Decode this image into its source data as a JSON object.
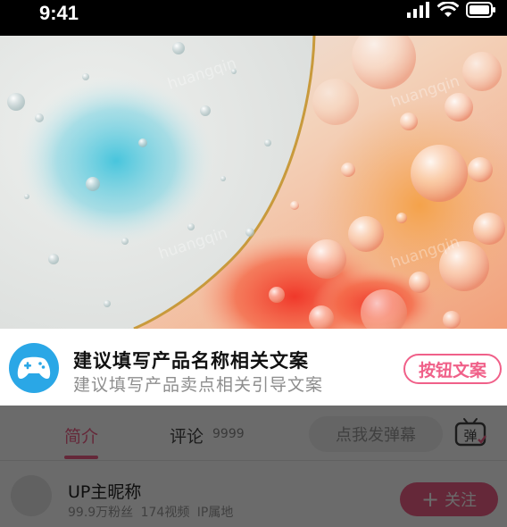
{
  "status_bar": {
    "time": "9:41"
  },
  "banner": {
    "watermark": "huangqin"
  },
  "promo": {
    "title": "建议填写产品名称相关文案",
    "subtitle": "建议填写产品卖点相关引导文案",
    "button_label": "按钮文案"
  },
  "tabs": {
    "intro_label": "简介",
    "comments_label": "评论",
    "comments_count": "9999",
    "danmaku_placeholder": "点我发弹幕",
    "danmaku_toggle_label": "弹"
  },
  "uploader": {
    "name": "UP主昵称",
    "stats": "99.9万粉丝 174视频 IP属地",
    "follow_label": "关注",
    "follow_plus": "+"
  },
  "colors": {
    "accent": "#f06089",
    "promo_icon": "#2aa7e6"
  }
}
